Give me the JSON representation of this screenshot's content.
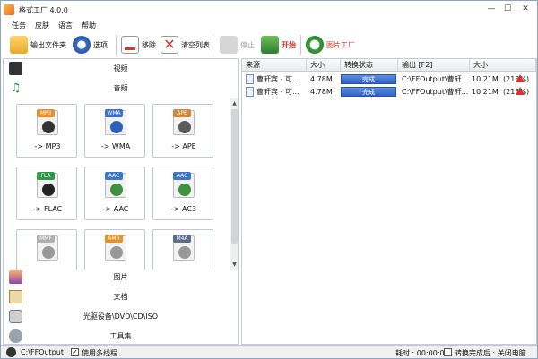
{
  "window": {
    "title": "格式工厂 4.0.0",
    "minimize": "—",
    "maximize": "☐",
    "close": "✕"
  },
  "menu": [
    "任务",
    "皮肤",
    "语言",
    "帮助"
  ],
  "toolbar": {
    "output_folder": "输出文件夹",
    "options": "选项",
    "remove": "移除",
    "clear_list": "清空列表",
    "stop": "停止",
    "start": "开始",
    "picture_factory": "图片工厂"
  },
  "categories": {
    "video": "视频",
    "audio": "音频",
    "picture": "图片",
    "document": "文档",
    "rom": "光驱设备\\DVD\\CD\\ISO",
    "tools": "工具集"
  },
  "tiles": [
    {
      "badge": "MP3",
      "label": "-> MP3",
      "badge_color": "#e8902a",
      "glyph_color": "#333333"
    },
    {
      "badge": "WMA",
      "label": "-> WMA",
      "badge_color": "#3b6fc9",
      "glyph_color": "#2b5fb8"
    },
    {
      "badge": "APE",
      "label": "-> APE",
      "badge_color": "#d2883a",
      "glyph_color": "#5a5a5a"
    },
    {
      "badge": "FLA",
      "label": "-> FLAC",
      "badge_color": "#2f9a4a",
      "glyph_color": "#222222"
    },
    {
      "badge": "AAC",
      "label": "-> AAC",
      "badge_color": "#3b78c9",
      "glyph_color": "#3e8f3e"
    },
    {
      "badge": "AAC",
      "label": "-> AC3",
      "badge_color": "#3b78c9",
      "glyph_color": "#3e8f3e"
    },
    {
      "badge": "MMF",
      "label": "",
      "badge_color": "#b0b0b0",
      "glyph_color": "#999999"
    },
    {
      "badge": "AMR",
      "label": "",
      "badge_color": "#e8902a",
      "glyph_color": "#999999"
    },
    {
      "badge": "M4A",
      "label": "",
      "badge_color": "#5c6f8a",
      "glyph_color": "#999999"
    }
  ],
  "table": {
    "columns": [
      "来源",
      "大小",
      "转换状态",
      "输出 [F2]",
      "大小"
    ],
    "rows": [
      {
        "source": "曹轩宾 - 可...",
        "size": "4.78M",
        "status": "完成",
        "output": "C:\\FFOutput\\曹轩...",
        "out_size": "10.21M",
        "ratio": "(213%)"
      },
      {
        "source": "曹轩宾 - 可...",
        "size": "4.78M",
        "status": "完成",
        "output": "C:\\FFOutput\\曹轩...",
        "out_size": "10.21M",
        "ratio": "(213%)"
      }
    ]
  },
  "statusbar": {
    "output_path": "C:\\FFOutput",
    "multithread": "使用多线程",
    "multithread_checked": "✓",
    "elapsed": "耗时 : 00:00:06",
    "after_done": "转换完成后 : 关闭电脑"
  },
  "colors": {
    "accent": "#2f64c6",
    "warn": "#d8352a",
    "border": "#c7ccd4"
  }
}
